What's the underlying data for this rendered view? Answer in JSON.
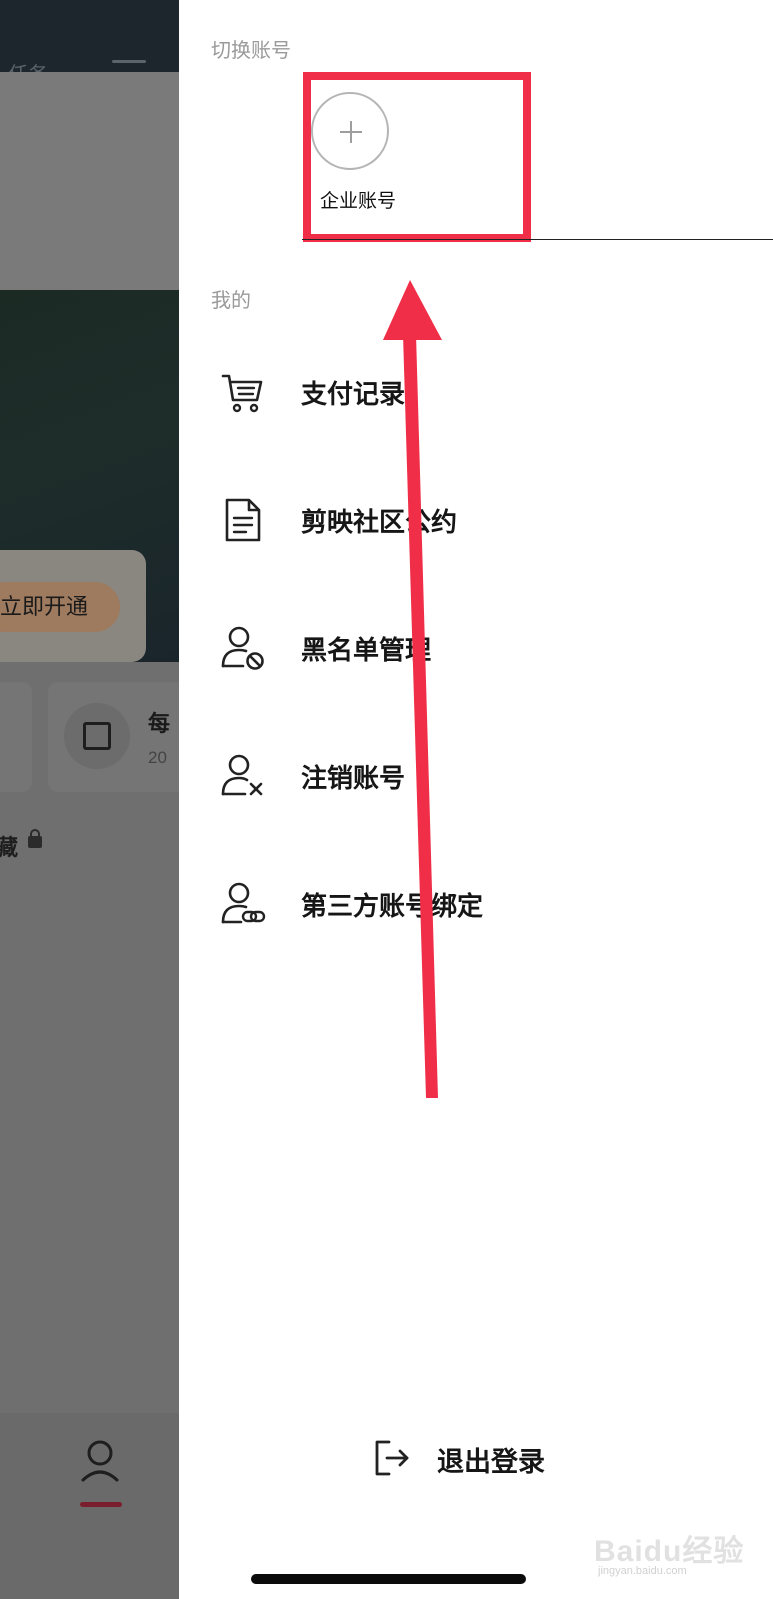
{
  "background_page": {
    "top_tab_partial": "任务",
    "vip_button": "立即开通",
    "tile_title_partial": "每",
    "tile_subtitle_partial": "20",
    "favorites_partial": "藏"
  },
  "drawer": {
    "switch_account_label": "切换账号",
    "enterprise_account_label": "企业账号",
    "mine_label": "我的",
    "menu": [
      {
        "label": "支付记录",
        "icon": "shopping-cart-icon"
      },
      {
        "label": "剪映社区公约",
        "icon": "document-icon"
      },
      {
        "label": "黑名单管理",
        "icon": "user-block-icon"
      },
      {
        "label": "注销账号",
        "icon": "user-remove-icon"
      },
      {
        "label": "第三方账号绑定",
        "icon": "user-link-icon"
      }
    ],
    "logout_label": "退出登录"
  },
  "watermark": {
    "text": "Baidu经验",
    "sub": "jingyan.baidu.com"
  },
  "colors": {
    "annotation_red": "#f02e47",
    "overlay_gray": "#6f6f6f",
    "banner_dark": "#1c2a24"
  }
}
